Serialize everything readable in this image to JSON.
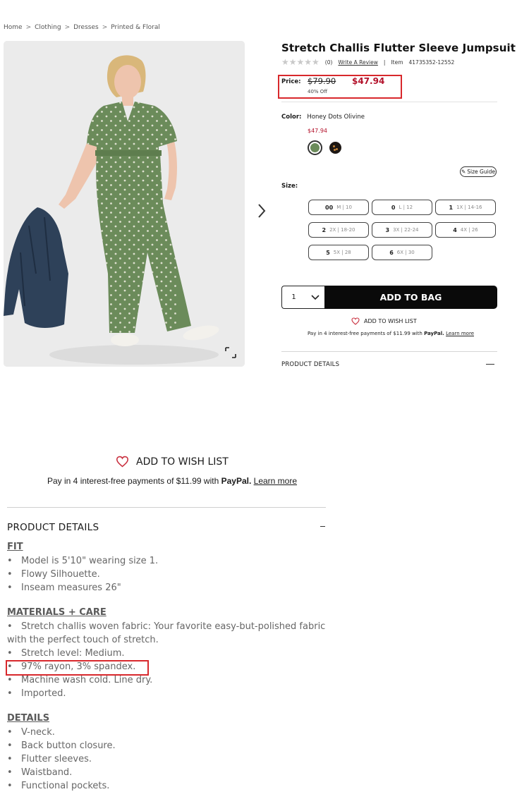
{
  "breadcrumb": [
    "Home",
    "Clothing",
    "Dresses",
    "Printed & Floral"
  ],
  "breadcrumb_separator": ">",
  "product": {
    "title": "Stretch Challis Flutter Sleeve Jumpsuit",
    "rating_count": "(0)",
    "write_review": "Write A Review",
    "item_separator": "|",
    "item_label": "Item",
    "item_number": "41735352-12552",
    "rating": 0
  },
  "price": {
    "label": "Price:",
    "original": "$79.90",
    "sale": "$47.94",
    "discount": "40% Off"
  },
  "color": {
    "label": "Color:",
    "selected_name": "Honey Dots Olivine",
    "price": "$47.94",
    "swatches": [
      {
        "name": "Honey Dots Olivine",
        "hex": "#6b8b5a",
        "selected": true
      },
      {
        "name": "Dark Floral",
        "hex": "#1d1714",
        "selected": false
      }
    ]
  },
  "size": {
    "label": "Size:",
    "guide_label": "Size Guide",
    "options": [
      {
        "size": "00",
        "alt": "M | 10"
      },
      {
        "size": "0",
        "alt": "L | 12"
      },
      {
        "size": "1",
        "alt": "1X | 14-16"
      },
      {
        "size": "2",
        "alt": "2X | 18-20"
      },
      {
        "size": "3",
        "alt": "3X | 22-24"
      },
      {
        "size": "4",
        "alt": "4X | 26"
      },
      {
        "size": "5",
        "alt": "5X | 28"
      },
      {
        "size": "6",
        "alt": "6X | 30"
      }
    ]
  },
  "purchase": {
    "quantity": "1",
    "add_to_bag": "ADD TO BAG",
    "wish_list": "ADD TO WISH LIST",
    "paypal_prefix": "Pay in 4 interest-free payments of $11.99 with",
    "paypal_brand": "PayPal.",
    "paypal_link": "Learn more"
  },
  "details_header": "PRODUCT DETAILS",
  "details": {
    "fit_title": "FIT",
    "fit": [
      "Model is 5'10\" wearing size 1.",
      "Flowy Silhouette.",
      "Inseam measures 26\""
    ],
    "materials_title": "MATERIALS + CARE",
    "materials_first_line": "Stretch challis woven fabric: Your favorite easy-but-polished fabric",
    "materials_first_line_cont": "with the perfect touch of stretch.",
    "materials": [
      "Stretch level: Medium.",
      "97% rayon, 3% spandex.",
      "Machine wash cold. Line dry.",
      "Imported."
    ],
    "details_title": "DETAILS",
    "items": [
      "V-neck.",
      "Back button closure.",
      "Flutter sleeves.",
      "Waistband.",
      "Functional pockets."
    ]
  },
  "colors": {
    "sale_red": "#b3122b",
    "highlight_red": "#d8282c",
    "button_black": "#0a0a0a",
    "jumpsuit_olive": "#6b8b5a"
  }
}
